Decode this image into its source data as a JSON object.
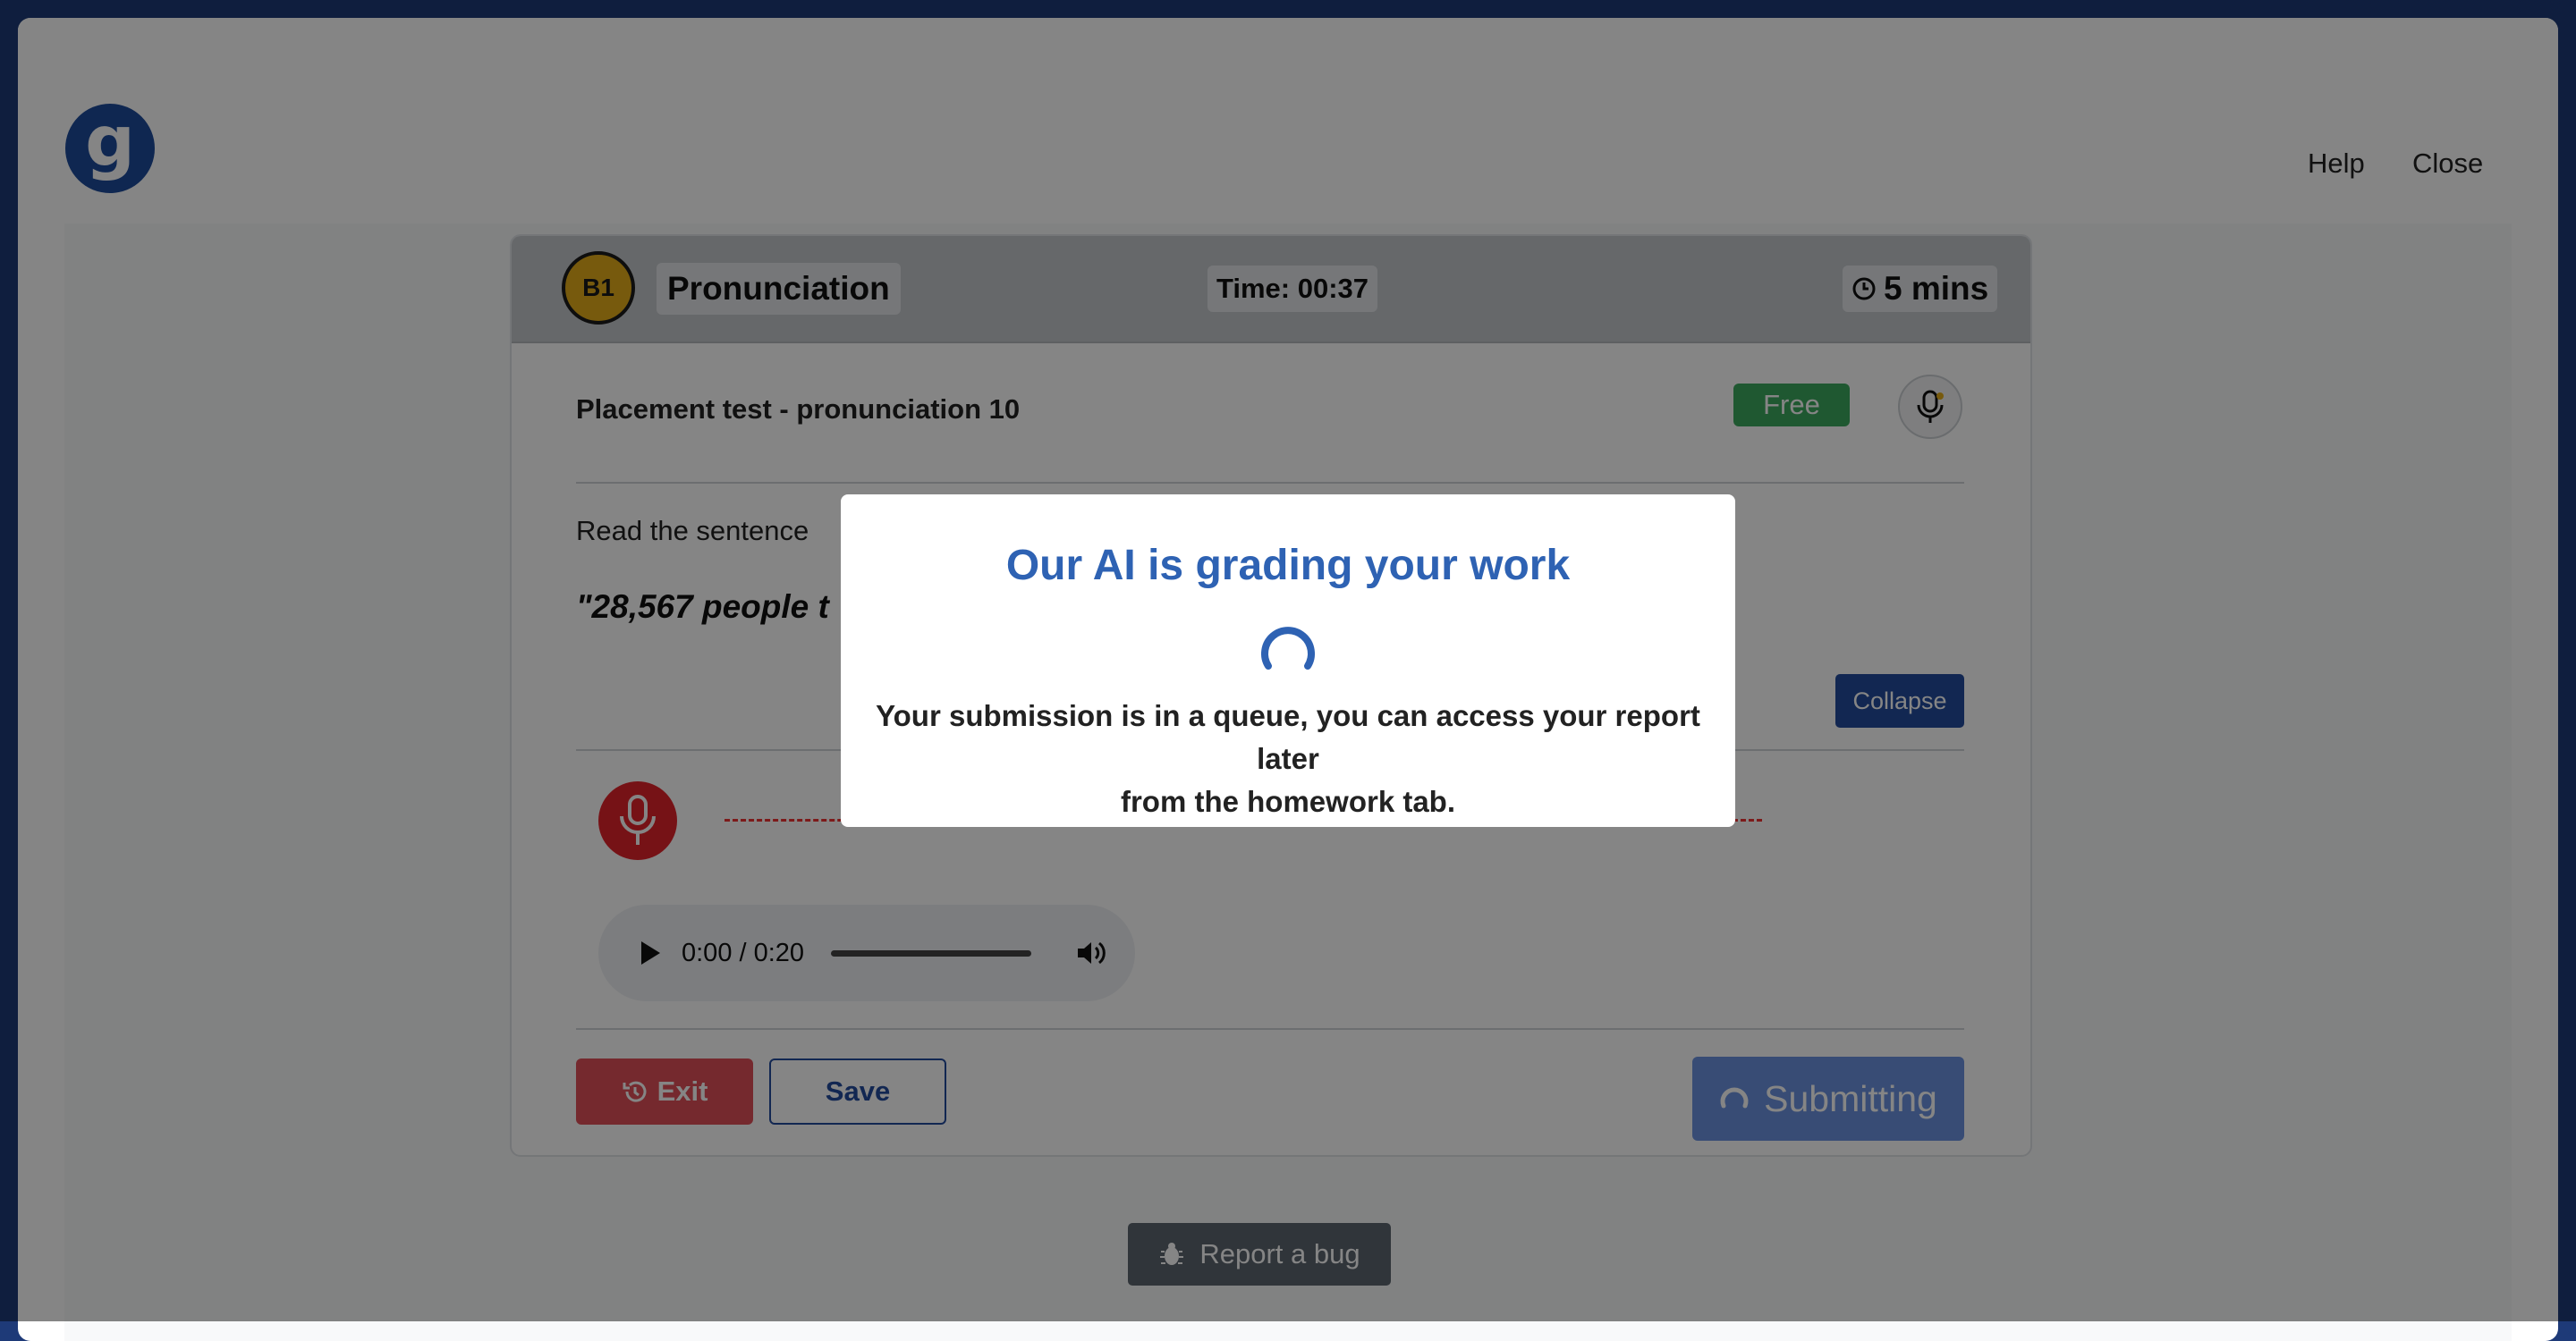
{
  "header": {
    "logo_letter": "g",
    "help_label": "Help",
    "close_label": "Close"
  },
  "card": {
    "level": "B1",
    "title": "Pronunciation",
    "timer": "Time: 00:37",
    "duration": "5 mins",
    "exercise_title": "Placement test - pronunciation 10",
    "price_badge": "Free",
    "instruction": "Read the sentence",
    "sentence": "\"28,567 people t",
    "collapse_label": "Collapse",
    "audio": {
      "time": "0:00 / 0:20"
    },
    "exit_label": "Exit",
    "save_label": "Save",
    "submit_label": "Submitting"
  },
  "report_bug_label": "Report a bug",
  "modal": {
    "title": "Our AI is grading your work",
    "message_line1": "Your submission is in a queue, you can access your report later",
    "message_line2": "from the homework tab."
  },
  "colors": {
    "brand": "#1e4b9c",
    "free": "#3daa5e",
    "record": "#e3242b",
    "exit": "#e05058",
    "submit": "#6b93e0",
    "modal_title": "#2e62b3",
    "level_badge": "#e4ac1a"
  }
}
